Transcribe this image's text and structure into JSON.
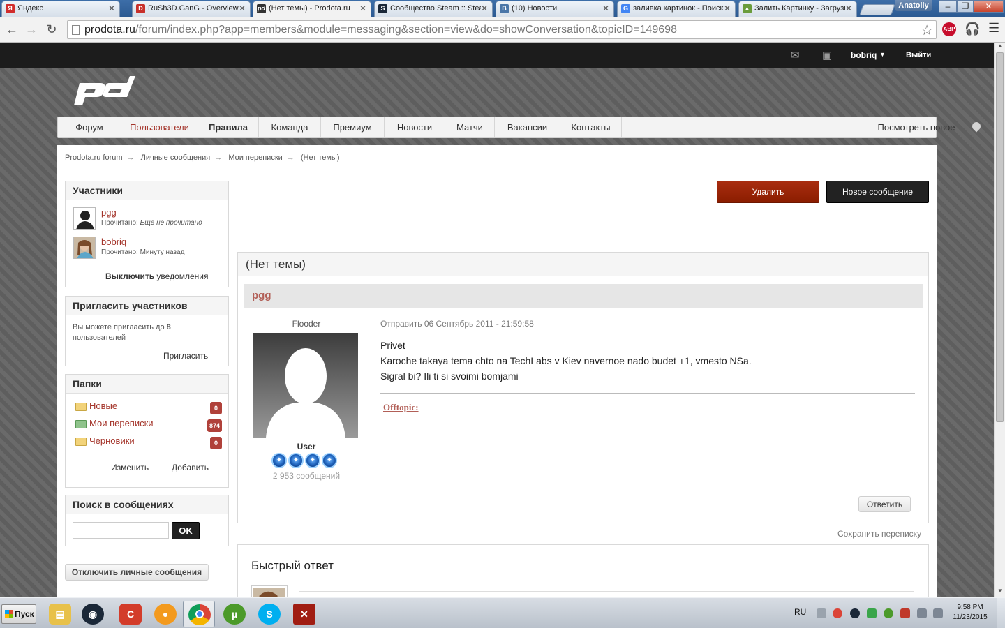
{
  "browser": {
    "tabs": [
      {
        "title": "Яндекс",
        "fav": "Я",
        "fav_color": "#d12c2c"
      },
      {
        "title": "RuSh3D.GanG - Overview",
        "fav": "D",
        "fav_color": "#c8302a"
      },
      {
        "title": "(Нет темы) - Prodota.ru",
        "fav": "pd",
        "fav_color": "#333333"
      },
      {
        "title": "Сообщество Steam :: Steam",
        "fav": "S",
        "fav_color": "#1b2838"
      },
      {
        "title": "(10) Новости",
        "fav": "В",
        "fav_color": "#4a76a8"
      },
      {
        "title": "заливка картинок - Поиск",
        "fav": "G",
        "fav_color": "#4285f4"
      },
      {
        "title": "Залить Картинку - Загрузка",
        "fav": "▲",
        "fav_color": "#6a9c3c"
      }
    ],
    "active_tab_index": 2,
    "profile_name": "Anatoliy",
    "url_host": "prodota.ru",
    "url_rest": "/forum/index.php?app=members&module=messaging&section=view&do=showConversation&topicID=149698",
    "abp_label": "ABP"
  },
  "userbar": {
    "username": "bobriq",
    "logout": "Выйти"
  },
  "nav": {
    "items": [
      "Форум",
      "Пользователи",
      "Правила",
      "Команда",
      "Премиум",
      "Новости",
      "Матчи",
      "Вакансии",
      "Контакты"
    ],
    "view_new": "Посмотреть новое"
  },
  "breadcrumb": [
    "Prodota.ru forum",
    "Личные сообщения",
    "Мои переписки",
    "(Нет темы)"
  ],
  "breadcrumb_sep": "→",
  "sidebar": {
    "participants": {
      "title": "Участники",
      "items": [
        {
          "name": "pgg",
          "read_label": "Прочитано:",
          "read_value": "Еще не прочитано"
        },
        {
          "name": "bobriq",
          "read_label": "Прочитано:",
          "read_value": "Минуту назад"
        }
      ],
      "notify_bold": "Выключить",
      "notify_rest": " уведомления"
    },
    "invite": {
      "title": "Пригласить участников",
      "text_before": "Вы можете пригласить до ",
      "count": "8",
      "text_after": " пользователей",
      "button": "Пригласить"
    },
    "folders": {
      "title": "Папки",
      "items": [
        {
          "name": "Новые",
          "count": "0"
        },
        {
          "name": "Мои переписки",
          "count": "874"
        },
        {
          "name": "Черновики",
          "count": "0"
        }
      ],
      "edit": "Изменить",
      "add": "Добавить"
    },
    "search": {
      "title": "Поиск в сообщениях",
      "placeholder": "",
      "button": "OK"
    },
    "disable_pm": "Отключить личные сообщения"
  },
  "actions": {
    "delete": "Удалить",
    "new_message": "Новое сообщение"
  },
  "conversation": {
    "title": "(Нет темы)",
    "author": "pgg",
    "rank": "Flooder",
    "group": "User",
    "pips": 4,
    "posts": "2 953 сообщений",
    "sent": "Отправить 06 Сентябрь 2011 - 21:59:58",
    "body_lines": [
      "Privet",
      "Karoche takaya tema chto na TechLabs v Kiev navernoe nado budet +1, vmesto NSa.",
      "Sigral bi? Ili ti si svoimi bomjami"
    ],
    "offtopic": "Offtopic:",
    "reply": "Ответить"
  },
  "save_conversation": "Сохранить переписку",
  "quick_reply": {
    "title": "Быстрый ответ"
  },
  "taskbar": {
    "start": "Пуск",
    "lang": "RU",
    "time": "9:58 PM",
    "date": "11/23/2015",
    "apps": [
      {
        "name": "explorer",
        "color": "#e8c14a"
      },
      {
        "name": "steam",
        "color": "#1b2838"
      },
      {
        "name": "ccleaner",
        "color": "#d33c2a"
      },
      {
        "name": "unknown-orange",
        "color": "#f39a1e"
      },
      {
        "name": "chrome",
        "color": "#db4437"
      },
      {
        "name": "utorrent",
        "color": "#4c9a2a"
      },
      {
        "name": "skype",
        "color": "#00aff0"
      },
      {
        "name": "dota2",
        "color": "#a01d12"
      }
    ]
  }
}
